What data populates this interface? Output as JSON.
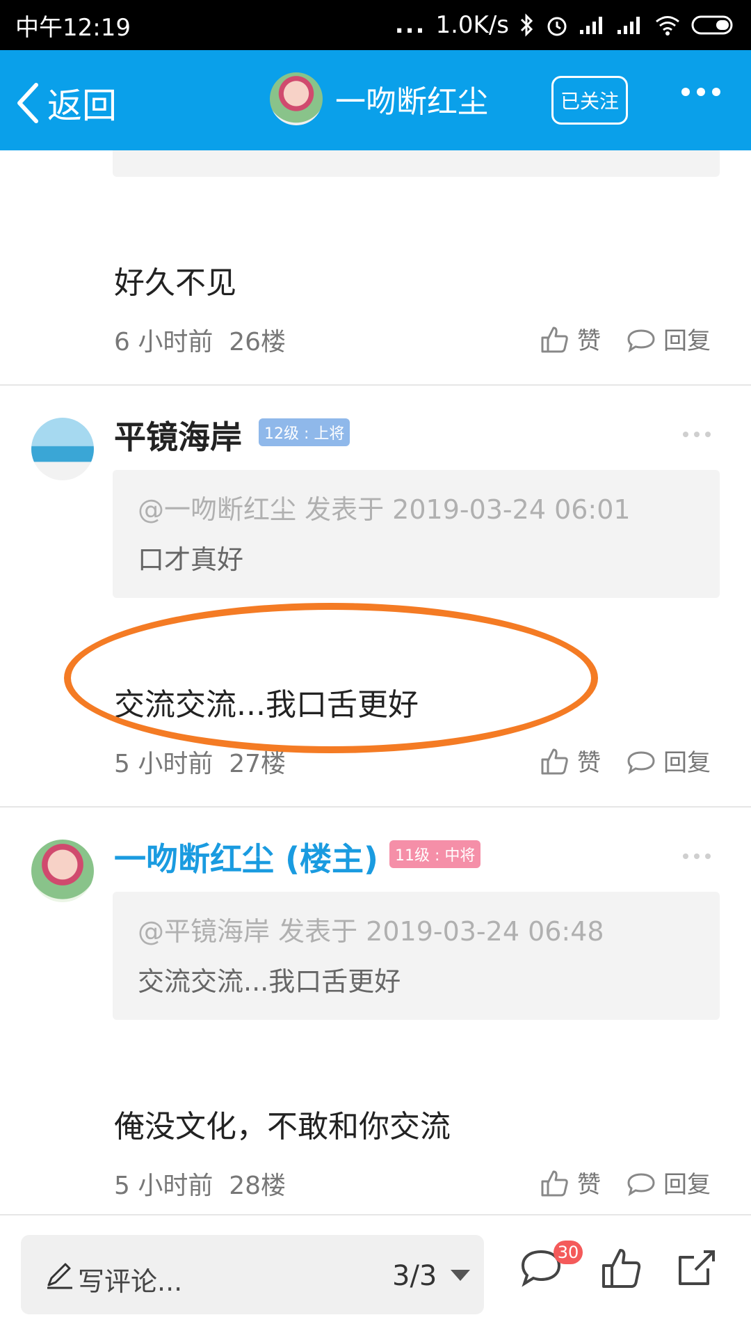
{
  "status_bar": {
    "time": "中午12:19",
    "dots": "...",
    "speed": "1.0K/s"
  },
  "nav": {
    "back_label": "返回",
    "title": "一吻断红尘",
    "follow_label": "已关注"
  },
  "posts": [
    {
      "content": "好久不见",
      "time": "6 小时前",
      "floor": "26楼",
      "like_label": "赞",
      "reply_label": "回复"
    },
    {
      "username": "平镜海岸",
      "level": "12级 : 上将",
      "quote_header": "@一吻断红尘 发表于 2019-03-24 06:01",
      "quote_text": "口才真好",
      "content": "交流交流...我口舌更好",
      "time": "5 小时前",
      "floor": "27楼",
      "like_label": "赞",
      "reply_label": "回复"
    },
    {
      "username": "一吻断红尘 (楼主)",
      "level": "11级 : 中将",
      "quote_header": "@平镜海岸 发表于 2019-03-24 06:48",
      "quote_text": "交流交流...我口舌更好",
      "content": "俺没文化，不敢和你交流",
      "time": "5 小时前",
      "floor": "28楼",
      "like_label": "赞",
      "reply_label": "回复"
    }
  ],
  "bottom_bar": {
    "comment_placeholder": "写评论...",
    "page_indicator": "3/3",
    "comment_count": "30"
  },
  "colors": {
    "nav_blue": "#0aa0ea",
    "owner_name": "#1a9be0",
    "highlight": "#f47b24",
    "badge_red": "#f45a5a"
  },
  "icons": [
    "back-chevron-icon",
    "avatar",
    "more-icon",
    "like-icon",
    "reply-icon",
    "pencil-icon",
    "caret-down-icon",
    "comment-icon",
    "share-icon",
    "wifi-icon",
    "battery-icon",
    "bluetooth-icon",
    "alarm-icon",
    "signal-icon"
  ]
}
